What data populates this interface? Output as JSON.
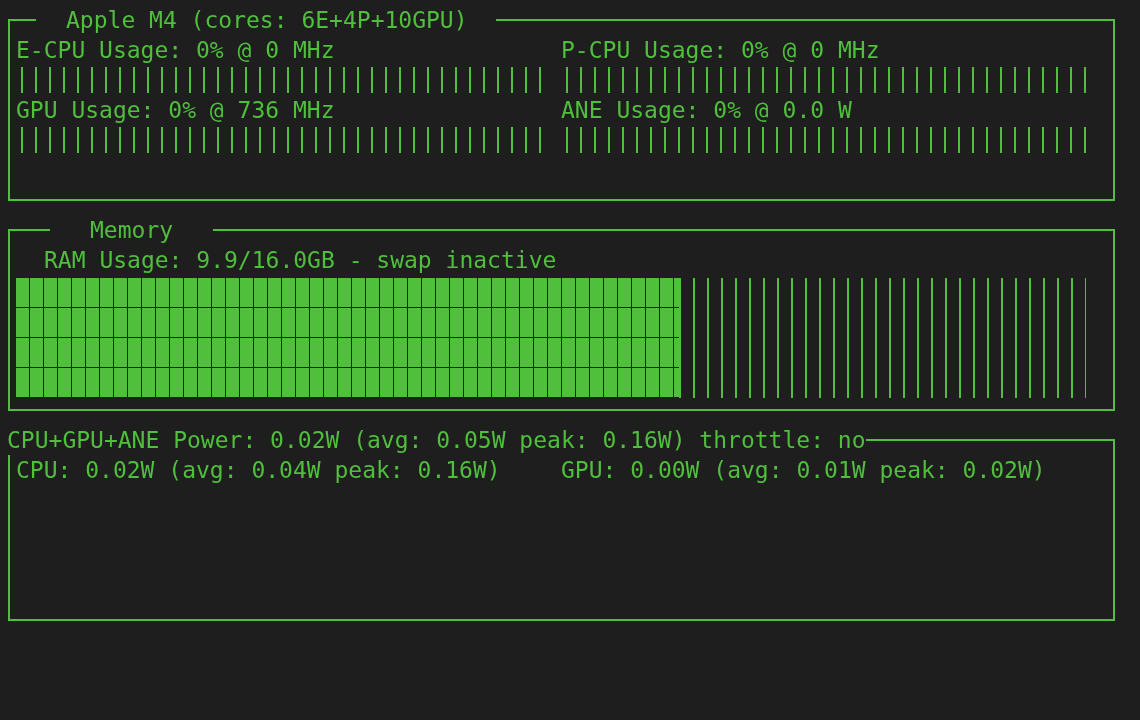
{
  "processor": {
    "title": "Apple M4 (cores: 6E+4P+10GPU)",
    "gauges": [
      {
        "label": "E-CPU Usage: 0% @ 0 MHz",
        "level": 0
      },
      {
        "label": "P-CPU Usage: 0% @ 0 MHz",
        "level": 0
      },
      {
        "label": "GPU Usage: 0% @ 736 MHz",
        "level": 0
      },
      {
        "label": "ANE Usage: 0% @ 0.0 W",
        "level": 0
      }
    ]
  },
  "memory": {
    "title": "Memory",
    "gauge": {
      "label": "RAM Usage: 9.9/16.0GB - swap inactive",
      "level": 0.62
    }
  },
  "power": {
    "title": "CPU+GPU+ANE Power: 0.02W (avg: 0.05W peak: 0.16W) throttle: no",
    "readings": [
      "CPU: 0.02W (avg: 0.04W peak: 0.16W)",
      "GPU: 0.00W (avg: 0.01W peak: 0.02W)"
    ]
  }
}
